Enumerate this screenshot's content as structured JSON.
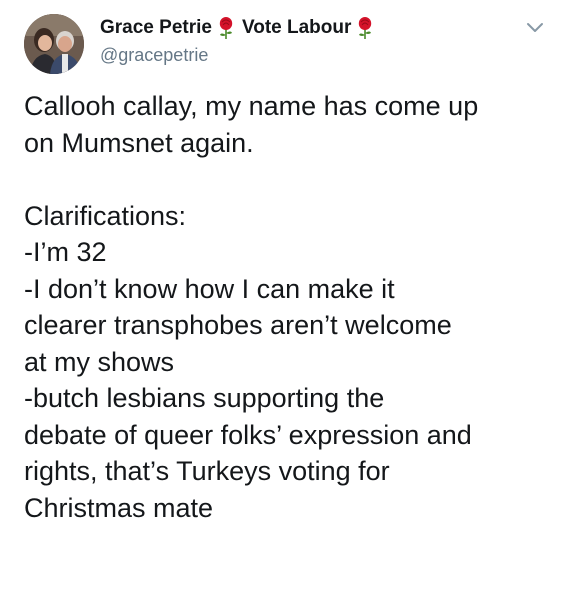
{
  "tweet": {
    "author": {
      "display_name_part1": "Grace Petrie",
      "display_name_part2": "Vote Labour",
      "handle": "@gracepetrie",
      "emoji_icon": "rose-icon"
    },
    "menu_icon": "chevron-down-icon",
    "lines": [
      "Callooh callay, my name has come up",
      "on Mumsnet again.",
      "",
      "Clarifications:",
      "-I’m 32",
      "-I don’t know how I can make it",
      "clearer transphobes aren’t welcome",
      "at my shows",
      "-butch lesbians supporting the",
      "debate of queer folks’ expression and",
      "rights, that’s Turkeys voting for",
      "Christmas mate"
    ]
  },
  "colors": {
    "text": "#14171a",
    "secondary": "#657786",
    "rose_red": "#d4122a",
    "rose_green": "#4a8a2a"
  }
}
